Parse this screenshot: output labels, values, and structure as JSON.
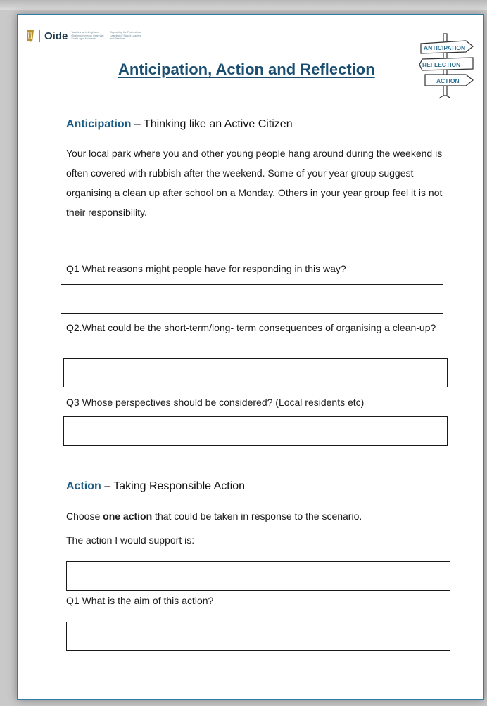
{
  "header": {
    "logo_text": "Oide",
    "logo_tagline_1": "Tacú leis an bhFoghlaim Ghairmiúil i measc Ceannairí Scoile agus Múinteoirí",
    "logo_tagline_2": "Supporting the Professional Learning of School Leaders and Teachers",
    "title": "Anticipation, Action and Reflection",
    "signpost_labels": [
      "ANTICIPATION",
      "REFLECTION",
      "ACTION"
    ]
  },
  "anticipation": {
    "heading_accent": "Anticipation",
    "heading_rest": " – Thinking like an Active Citizen",
    "scenario": "Your local park where you and other young people hang around during the weekend is often covered with rubbish after the weekend. Some of your year group suggest organising a clean up after school on a Monday. Others in your year group feel it is not their responsibility.",
    "q1": "Q1 What reasons might people have for responding in this way?",
    "q2": "Q2.What could be the short-term/long- term consequences of organising a clean-up?",
    "q3": "Q3 Whose perspectives should be considered? (Local residents etc)"
  },
  "action": {
    "heading_accent": "Action",
    "heading_rest": " – Taking Responsible Action",
    "choose_pre": "Choose ",
    "choose_bold": "one action",
    "choose_post": " that could be taken in response to the scenario.",
    "support_label": "The action I would support is:",
    "q1": "Q1 What is the aim of this action?"
  },
  "colors": {
    "accent": "#1b5d86",
    "title": "#1b4f72",
    "border": "#2e7fa8"
  }
}
